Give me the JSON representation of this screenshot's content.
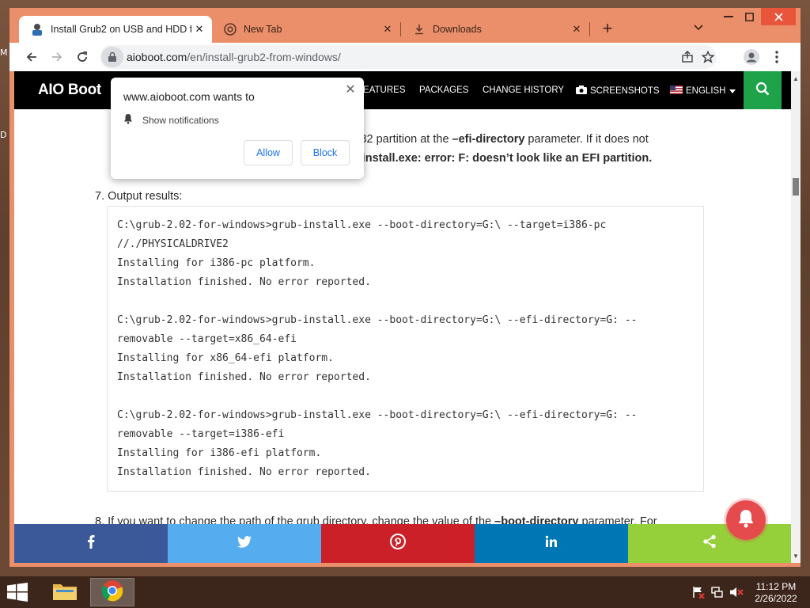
{
  "desktop": {
    "edge_text_1": "M",
    "edge_text_2": "D"
  },
  "browser": {
    "tabs": [
      {
        "title": "Install Grub2 on USB and HDD fr",
        "icon": "aioboot-favicon",
        "active": true
      },
      {
        "title": "New Tab",
        "icon": "chrome-icon",
        "active": false
      },
      {
        "title": "Downloads",
        "icon": "download-icon",
        "active": false
      }
    ],
    "new_tab_label": "+",
    "url_host": "aioboot.com",
    "url_path": "/en/install-grub2-from-windows/"
  },
  "site": {
    "logo": "AIO Boot",
    "nav": [
      {
        "label": "FEATURES"
      },
      {
        "label": "PACKAGES"
      },
      {
        "label": "CHANGE HISTORY"
      },
      {
        "label": "SCREENSHOTS",
        "icon": "camera-icon"
      },
      {
        "label": "ENGLISH",
        "icon": "us-flag-icon",
        "dropdown": true
      }
    ],
    "accent_color": "#1ea34b"
  },
  "article": {
    "line1_pre": "AT32 partition at the ",
    "line1_bold": "–efi-directory",
    "line1_post": " parameter. If it does not",
    "line2_bold": "b-install.exe: error: F: doesn’t look like an EFI partition.",
    "step7": "7. Output results:",
    "code_lines": [
      "C:\\grub-2.02-for-windows>grub-install.exe --boot-directory=G:\\ --target=i386-pc",
      "//./PHYSICALDRIVE2",
      "Installing for i386-pc platform.",
      "Installation finished. No error reported.",
      "",
      "C:\\grub-2.02-for-windows>grub-install.exe --boot-directory=G:\\ --efi-directory=G: --",
      "removable --target=x86_64-efi",
      "Installing for x86_64-efi platform.",
      "Installation finished. No error reported.",
      "",
      "C:\\grub-2.02-for-windows>grub-install.exe --boot-directory=G:\\ --efi-directory=G: --",
      "removable --target=i386-efi",
      "Installing for i386-efi platform.",
      "Installation finished. No error reported."
    ],
    "step8_pre": "8. If you want to change the path of the grub directory, change the value of the ",
    "step8_bold": "–boot-directory",
    "step8_post": " parameter. For"
  },
  "permission_popup": {
    "title": "www.aioboot.com wants to",
    "request": "Show notifications",
    "allow_label": "Allow",
    "block_label": "Block"
  },
  "share_bar": [
    {
      "network": "facebook",
      "icon": "facebook-icon",
      "color": "#3b5998"
    },
    {
      "network": "twitter",
      "icon": "twitter-icon",
      "color": "#55acee"
    },
    {
      "network": "pinterest",
      "icon": "pinterest-icon",
      "color": "#cb2027"
    },
    {
      "network": "linkedin",
      "icon": "linkedin-icon",
      "color": "#0077b5"
    },
    {
      "network": "share",
      "icon": "share-icon",
      "color": "#95d03a"
    }
  ],
  "taskbar": {
    "time": "11:12 PM",
    "date": "2/26/2022"
  }
}
